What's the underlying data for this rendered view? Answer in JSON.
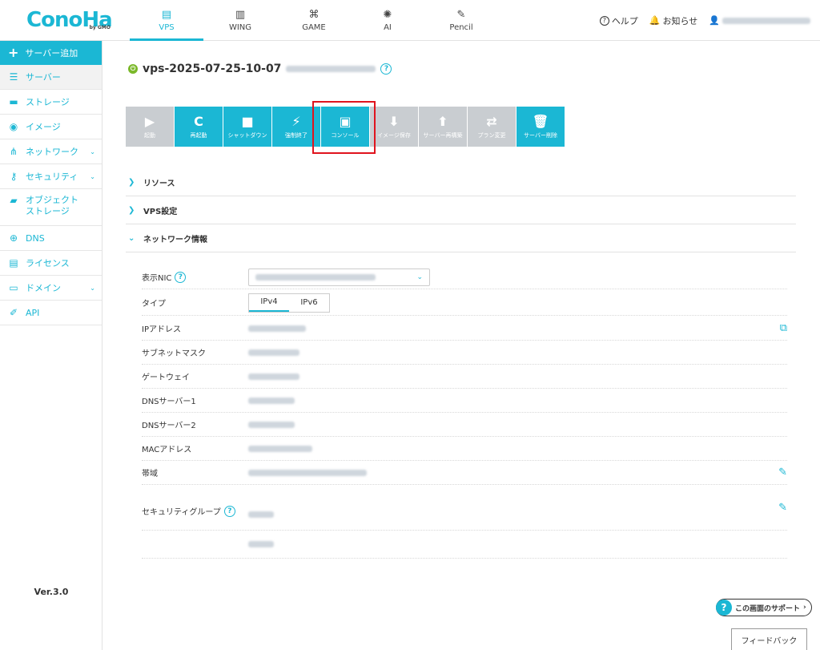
{
  "logo": {
    "text": "ConoHa",
    "sub": "by GMO"
  },
  "top_tabs": [
    {
      "label": "VPS",
      "icon": "server-icon",
      "glyph": "▤",
      "active": true
    },
    {
      "label": "WING",
      "icon": "building-icon",
      "glyph": "▥",
      "active": false
    },
    {
      "label": "GAME",
      "icon": "gamepad-icon",
      "glyph": "⌘",
      "active": false
    },
    {
      "label": "AI",
      "icon": "brain-icon",
      "glyph": "✺",
      "active": false
    },
    {
      "label": "Pencil",
      "icon": "pencil-doc-icon",
      "glyph": "✎",
      "active": false
    }
  ],
  "header_right": {
    "help": "ヘルプ",
    "notice": "お知らせ"
  },
  "sidebar": {
    "add": "サーバー追加",
    "items": [
      {
        "label": "サーバー",
        "icon": "server-icon",
        "glyph": "☰",
        "active": true,
        "chevron": false
      },
      {
        "label": "ストレージ",
        "icon": "storage-icon",
        "glyph": "▬",
        "active": false,
        "chevron": false
      },
      {
        "label": "イメージ",
        "icon": "globe-icon",
        "glyph": "◉",
        "active": false,
        "chevron": false
      },
      {
        "label": "ネットワーク",
        "icon": "network-icon",
        "glyph": "⋔",
        "active": false,
        "chevron": true
      },
      {
        "label": "セキュリティ",
        "icon": "key-icon",
        "glyph": "⚷",
        "active": false,
        "chevron": true
      },
      {
        "label": "オブジェクト\nストレージ",
        "icon": "folder-icon",
        "glyph": "▰",
        "active": false,
        "chevron": false,
        "tall": true
      },
      {
        "label": "DNS",
        "icon": "dns-globe-icon",
        "glyph": "⊕",
        "active": false,
        "chevron": false
      },
      {
        "label": "ライセンス",
        "icon": "license-icon",
        "glyph": "▤",
        "active": false,
        "chevron": false
      },
      {
        "label": "ドメイン",
        "icon": "domain-icon",
        "glyph": "▭",
        "active": false,
        "chevron": true
      },
      {
        "label": "API",
        "icon": "api-icon",
        "glyph": "✐",
        "active": false,
        "chevron": false
      }
    ],
    "version": "Ver.3.0"
  },
  "server": {
    "name": "vps-2025-07-25-10-07"
  },
  "toolbar": [
    {
      "label": "起動",
      "icon": "play-icon",
      "glyph": "▶",
      "enabled": false
    },
    {
      "label": "再起動",
      "icon": "restart-icon",
      "glyph": "C",
      "enabled": true
    },
    {
      "label": "シャットダウン",
      "icon": "stop-icon",
      "glyph": "■",
      "enabled": true
    },
    {
      "label": "強制終了",
      "icon": "plug-icon",
      "glyph": "⚡",
      "enabled": true
    },
    {
      "label": "コンソール",
      "icon": "console-icon",
      "glyph": "▣",
      "enabled": true
    },
    {
      "label": "イメージ保存",
      "icon": "image-save-icon",
      "glyph": "⬇",
      "enabled": false
    },
    {
      "label": "サーバー再構築",
      "icon": "rebuild-icon",
      "glyph": "⬆",
      "enabled": false
    },
    {
      "label": "プラン変更",
      "icon": "swap-icon",
      "glyph": "⇄",
      "enabled": false
    },
    {
      "label": "サーバー削除",
      "icon": "trash-icon",
      "glyph": "🗑",
      "enabled": true
    }
  ],
  "sections": [
    {
      "label": "リソース",
      "expanded": false
    },
    {
      "label": "VPS設定",
      "expanded": false
    },
    {
      "label": "ネットワーク情報",
      "expanded": true
    }
  ],
  "network": {
    "nic_label": "表示NIC",
    "type_label": "タイプ",
    "type_options": [
      "IPv4",
      "IPv6"
    ],
    "fields": [
      {
        "label": "IPアドレス"
      },
      {
        "label": "サブネットマスク"
      },
      {
        "label": "ゲートウェイ"
      },
      {
        "label": "DNSサーバー1"
      },
      {
        "label": "DNSサーバー2"
      },
      {
        "label": "MACアドレス"
      },
      {
        "label": "帯域"
      }
    ],
    "security_group_label": "セキュリティグループ"
  },
  "support_label": "この画面のサポート",
  "feedback_label": "フィードバック",
  "colors": {
    "accent": "#1bb7d4",
    "disabled": "#c9cdd1",
    "highlight": "#e0141e",
    "power": "#7ab829"
  }
}
